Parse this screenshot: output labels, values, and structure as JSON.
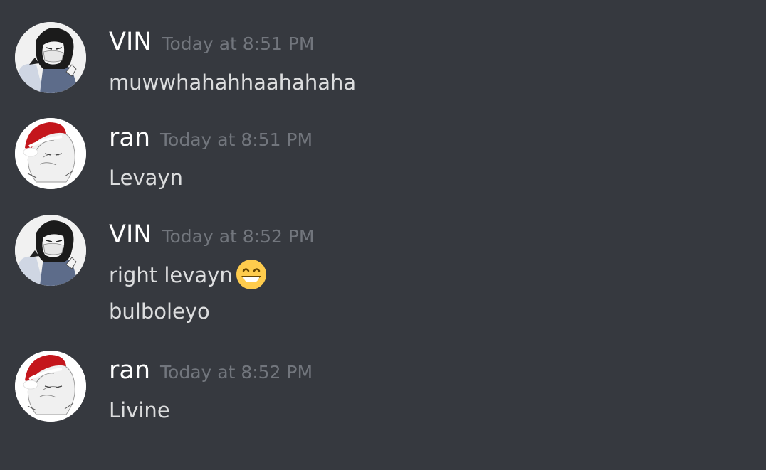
{
  "messages": [
    {
      "author": "VIN",
      "timestamp": "Today at 8:51 PM",
      "lines": [
        "muwwhahahhaahahaha"
      ]
    },
    {
      "author": "ran",
      "timestamp": "Today at 8:51 PM",
      "lines": [
        "Levayn"
      ]
    },
    {
      "author": "VIN",
      "timestamp": "Today at 8:52 PM",
      "lines": [
        "right levayn",
        "bulboleyo"
      ],
      "emoji": "grinning-face-emoji"
    },
    {
      "author": "ran",
      "timestamp": "Today at 8:52 PM",
      "lines": [
        "Livine"
      ]
    }
  ],
  "icons": {
    "vin_avatar": "vin-avatar-icon",
    "ran_avatar": "ran-avatar-santa-hat-icon",
    "emoji": "grinning-face-emoji"
  },
  "colors": {
    "background": "#36393f",
    "username": "#ffffff",
    "timestamp": "#72767d",
    "message_text": "#dcddde",
    "santa_hat": "#c4161c"
  }
}
